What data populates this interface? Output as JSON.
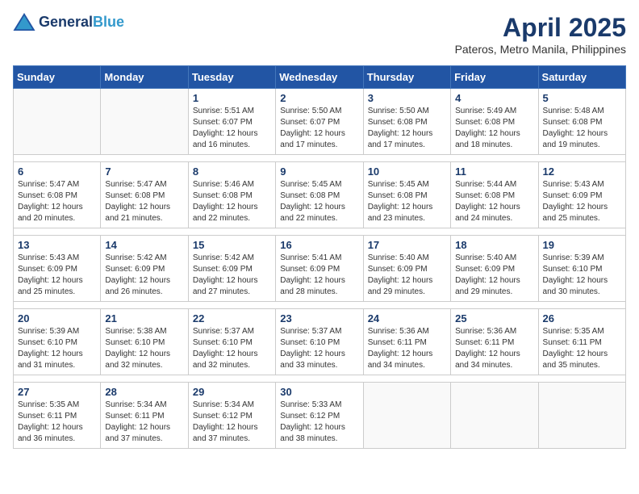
{
  "header": {
    "logo_general": "General",
    "logo_blue": "Blue",
    "month_year": "April 2025",
    "location": "Pateros, Metro Manila, Philippines"
  },
  "weekdays": [
    "Sunday",
    "Monday",
    "Tuesday",
    "Wednesday",
    "Thursday",
    "Friday",
    "Saturday"
  ],
  "weeks": [
    [
      {
        "day": "",
        "sunrise": "",
        "sunset": "",
        "daylight": ""
      },
      {
        "day": "",
        "sunrise": "",
        "sunset": "",
        "daylight": ""
      },
      {
        "day": "1",
        "sunrise": "Sunrise: 5:51 AM",
        "sunset": "Sunset: 6:07 PM",
        "daylight": "Daylight: 12 hours and 16 minutes."
      },
      {
        "day": "2",
        "sunrise": "Sunrise: 5:50 AM",
        "sunset": "Sunset: 6:07 PM",
        "daylight": "Daylight: 12 hours and 17 minutes."
      },
      {
        "day": "3",
        "sunrise": "Sunrise: 5:50 AM",
        "sunset": "Sunset: 6:08 PM",
        "daylight": "Daylight: 12 hours and 17 minutes."
      },
      {
        "day": "4",
        "sunrise": "Sunrise: 5:49 AM",
        "sunset": "Sunset: 6:08 PM",
        "daylight": "Daylight: 12 hours and 18 minutes."
      },
      {
        "day": "5",
        "sunrise": "Sunrise: 5:48 AM",
        "sunset": "Sunset: 6:08 PM",
        "daylight": "Daylight: 12 hours and 19 minutes."
      }
    ],
    [
      {
        "day": "6",
        "sunrise": "Sunrise: 5:47 AM",
        "sunset": "Sunset: 6:08 PM",
        "daylight": "Daylight: 12 hours and 20 minutes."
      },
      {
        "day": "7",
        "sunrise": "Sunrise: 5:47 AM",
        "sunset": "Sunset: 6:08 PM",
        "daylight": "Daylight: 12 hours and 21 minutes."
      },
      {
        "day": "8",
        "sunrise": "Sunrise: 5:46 AM",
        "sunset": "Sunset: 6:08 PM",
        "daylight": "Daylight: 12 hours and 22 minutes."
      },
      {
        "day": "9",
        "sunrise": "Sunrise: 5:45 AM",
        "sunset": "Sunset: 6:08 PM",
        "daylight": "Daylight: 12 hours and 22 minutes."
      },
      {
        "day": "10",
        "sunrise": "Sunrise: 5:45 AM",
        "sunset": "Sunset: 6:08 PM",
        "daylight": "Daylight: 12 hours and 23 minutes."
      },
      {
        "day": "11",
        "sunrise": "Sunrise: 5:44 AM",
        "sunset": "Sunset: 6:08 PM",
        "daylight": "Daylight: 12 hours and 24 minutes."
      },
      {
        "day": "12",
        "sunrise": "Sunrise: 5:43 AM",
        "sunset": "Sunset: 6:09 PM",
        "daylight": "Daylight: 12 hours and 25 minutes."
      }
    ],
    [
      {
        "day": "13",
        "sunrise": "Sunrise: 5:43 AM",
        "sunset": "Sunset: 6:09 PM",
        "daylight": "Daylight: 12 hours and 25 minutes."
      },
      {
        "day": "14",
        "sunrise": "Sunrise: 5:42 AM",
        "sunset": "Sunset: 6:09 PM",
        "daylight": "Daylight: 12 hours and 26 minutes."
      },
      {
        "day": "15",
        "sunrise": "Sunrise: 5:42 AM",
        "sunset": "Sunset: 6:09 PM",
        "daylight": "Daylight: 12 hours and 27 minutes."
      },
      {
        "day": "16",
        "sunrise": "Sunrise: 5:41 AM",
        "sunset": "Sunset: 6:09 PM",
        "daylight": "Daylight: 12 hours and 28 minutes."
      },
      {
        "day": "17",
        "sunrise": "Sunrise: 5:40 AM",
        "sunset": "Sunset: 6:09 PM",
        "daylight": "Daylight: 12 hours and 29 minutes."
      },
      {
        "day": "18",
        "sunrise": "Sunrise: 5:40 AM",
        "sunset": "Sunset: 6:09 PM",
        "daylight": "Daylight: 12 hours and 29 minutes."
      },
      {
        "day": "19",
        "sunrise": "Sunrise: 5:39 AM",
        "sunset": "Sunset: 6:10 PM",
        "daylight": "Daylight: 12 hours and 30 minutes."
      }
    ],
    [
      {
        "day": "20",
        "sunrise": "Sunrise: 5:39 AM",
        "sunset": "Sunset: 6:10 PM",
        "daylight": "Daylight: 12 hours and 31 minutes."
      },
      {
        "day": "21",
        "sunrise": "Sunrise: 5:38 AM",
        "sunset": "Sunset: 6:10 PM",
        "daylight": "Daylight: 12 hours and 32 minutes."
      },
      {
        "day": "22",
        "sunrise": "Sunrise: 5:37 AM",
        "sunset": "Sunset: 6:10 PM",
        "daylight": "Daylight: 12 hours and 32 minutes."
      },
      {
        "day": "23",
        "sunrise": "Sunrise: 5:37 AM",
        "sunset": "Sunset: 6:10 PM",
        "daylight": "Daylight: 12 hours and 33 minutes."
      },
      {
        "day": "24",
        "sunrise": "Sunrise: 5:36 AM",
        "sunset": "Sunset: 6:11 PM",
        "daylight": "Daylight: 12 hours and 34 minutes."
      },
      {
        "day": "25",
        "sunrise": "Sunrise: 5:36 AM",
        "sunset": "Sunset: 6:11 PM",
        "daylight": "Daylight: 12 hours and 34 minutes."
      },
      {
        "day": "26",
        "sunrise": "Sunrise: 5:35 AM",
        "sunset": "Sunset: 6:11 PM",
        "daylight": "Daylight: 12 hours and 35 minutes."
      }
    ],
    [
      {
        "day": "27",
        "sunrise": "Sunrise: 5:35 AM",
        "sunset": "Sunset: 6:11 PM",
        "daylight": "Daylight: 12 hours and 36 minutes."
      },
      {
        "day": "28",
        "sunrise": "Sunrise: 5:34 AM",
        "sunset": "Sunset: 6:11 PM",
        "daylight": "Daylight: 12 hours and 37 minutes."
      },
      {
        "day": "29",
        "sunrise": "Sunrise: 5:34 AM",
        "sunset": "Sunset: 6:12 PM",
        "daylight": "Daylight: 12 hours and 37 minutes."
      },
      {
        "day": "30",
        "sunrise": "Sunrise: 5:33 AM",
        "sunset": "Sunset: 6:12 PM",
        "daylight": "Daylight: 12 hours and 38 minutes."
      },
      {
        "day": "",
        "sunrise": "",
        "sunset": "",
        "daylight": ""
      },
      {
        "day": "",
        "sunrise": "",
        "sunset": "",
        "daylight": ""
      },
      {
        "day": "",
        "sunrise": "",
        "sunset": "",
        "daylight": ""
      }
    ]
  ]
}
